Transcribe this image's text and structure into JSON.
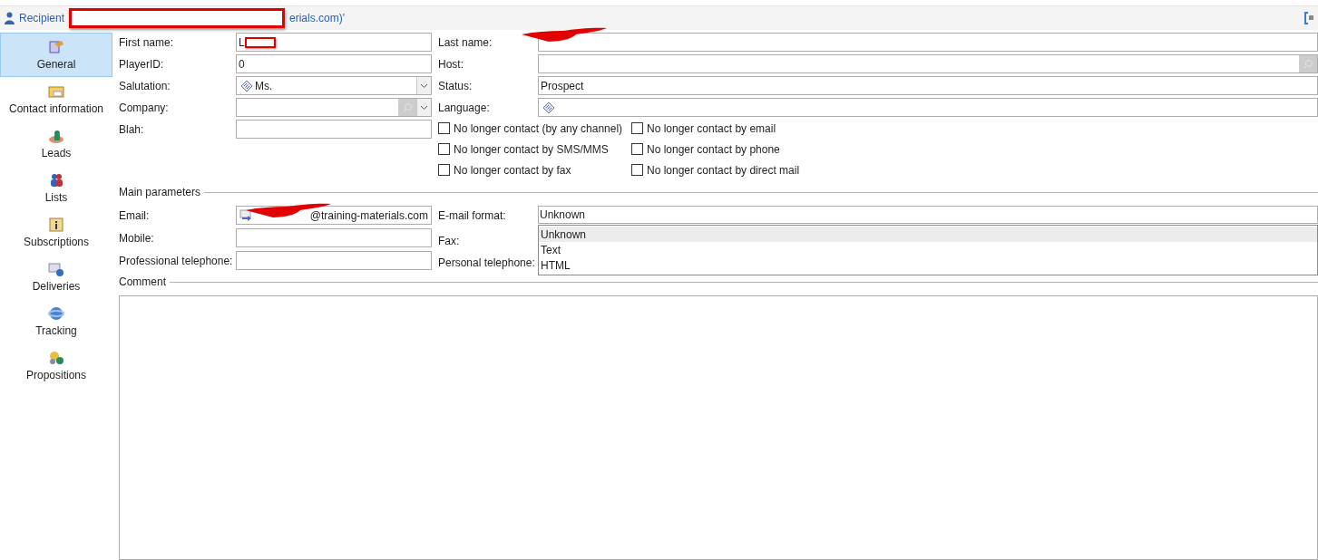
{
  "header": {
    "title": "Recipient",
    "title_tail": "erials.com)'"
  },
  "sidebar": {
    "items": [
      {
        "label": "General",
        "selected": true
      },
      {
        "label": "Contact information",
        "selected": false
      },
      {
        "label": "Leads",
        "selected": false
      },
      {
        "label": "Lists",
        "selected": false
      },
      {
        "label": "Subscriptions",
        "selected": false
      },
      {
        "label": "Deliveries",
        "selected": false
      },
      {
        "label": "Tracking",
        "selected": false
      },
      {
        "label": "Propositions",
        "selected": false
      }
    ]
  },
  "fields_left": [
    {
      "label": "First name:",
      "kind": "text",
      "value": "L",
      "redacted": true
    },
    {
      "label": "PlayerID:",
      "kind": "text",
      "value": "0"
    },
    {
      "label": "Salutation:",
      "kind": "enum-combo",
      "value": "Ms."
    },
    {
      "label": "Company:",
      "kind": "lookup-combo"
    },
    {
      "label": "Blah:",
      "kind": "text"
    }
  ],
  "fields_right": [
    {
      "label": "Last name:",
      "kind": "text",
      "redacted": true
    },
    {
      "label": "Host:",
      "kind": "lookup"
    },
    {
      "label": "Status:",
      "kind": "text",
      "value": "Prospect"
    },
    {
      "label": "Language:",
      "kind": "enum"
    }
  ],
  "checkboxes": [
    {
      "label": "No longer contact (by any channel)",
      "checked": false
    },
    {
      "label": "No longer contact by email",
      "checked": false
    },
    {
      "label": "No longer contact by SMS/MMS",
      "checked": false
    },
    {
      "label": "No longer contact by phone",
      "checked": false
    },
    {
      "label": "No longer contact by fax",
      "checked": false
    },
    {
      "label": "No longer contact by direct mail",
      "checked": false
    }
  ],
  "main_parameters": {
    "title": "Main parameters",
    "email": {
      "label": "Email:",
      "value": "@training-materials.com"
    },
    "email_format": {
      "label": "E-mail format:",
      "value": "Unknown",
      "options": [
        {
          "label": "Unknown",
          "selected": true
        },
        {
          "label": "Text",
          "selected": false
        },
        {
          "label": "HTML",
          "selected": false
        }
      ]
    },
    "mobile": {
      "label": "Mobile:"
    },
    "fax": {
      "label": "Fax:"
    },
    "professional_telephone": {
      "label": "Professional telephone:"
    },
    "personal_telephone": {
      "label": "Personal telephone:"
    }
  },
  "comment": {
    "title": "Comment"
  }
}
